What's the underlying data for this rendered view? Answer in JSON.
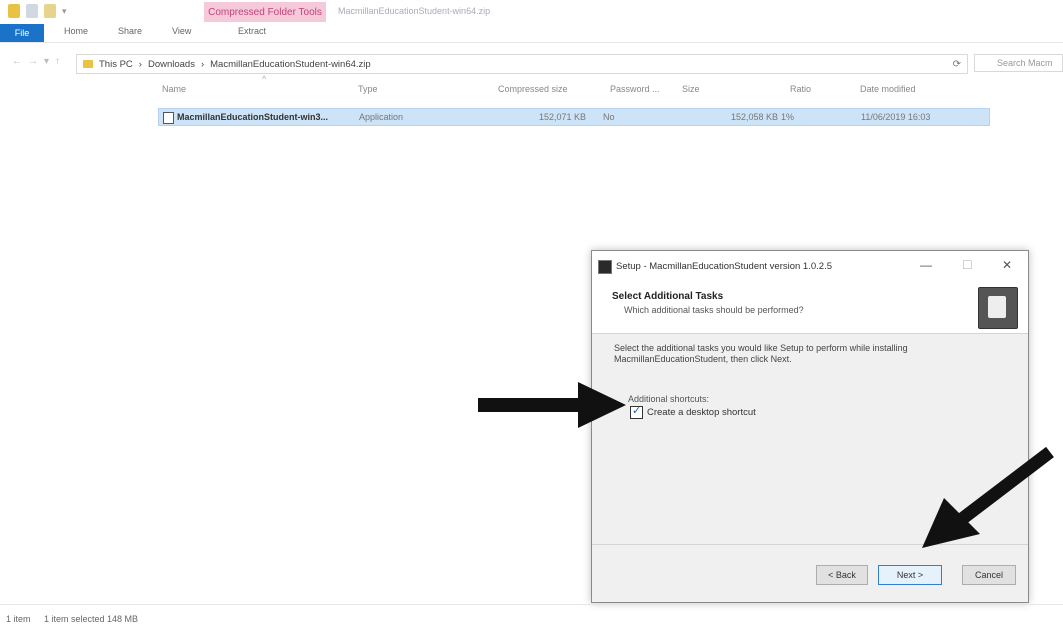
{
  "window": {
    "context_tab": "Compressed Folder Tools",
    "title": "MacmillanEducationStudent-win64.zip"
  },
  "ribbon": {
    "tabs": [
      "File",
      "Home",
      "Share",
      "View",
      "Extract"
    ]
  },
  "address": {
    "crumbs": [
      "This PC",
      "›",
      "Downloads",
      "›",
      "MacmillanEducationStudent-win64.zip"
    ],
    "search_placeholder": "Search Macm"
  },
  "file_list": {
    "columns": [
      "Name",
      "Type",
      "Compressed size",
      "Password ...",
      "Size",
      "Ratio",
      "Date modified"
    ],
    "rows": [
      {
        "name": "MacmillanEducationStudent-win3...",
        "type": "Application",
        "compressed_size": "152,071 KB",
        "password": "No",
        "size": "152,058 KB",
        "ratio": "1%",
        "date_modified": "11/06/2019 16:03"
      }
    ]
  },
  "status": {
    "count": "1 item",
    "selected": "1 item selected  148 MB"
  },
  "dialog": {
    "title": "Setup - MacmillanEducationStudent version 1.0.2.5",
    "min": "—",
    "max": "☐",
    "close": "✕",
    "heading": "Select Additional Tasks",
    "subheading": "Which additional tasks should be performed?",
    "body": "Select the additional tasks you would like Setup to perform while installing MacmillanEducationStudent, then click Next.",
    "additional_label": "Additional shortcuts:",
    "checkbox_label": "Create a desktop shortcut",
    "checkbox_checked": true,
    "back": "< Back",
    "next": "Next >",
    "cancel": "Cancel"
  },
  "colors": {
    "accent": "#1a73c9",
    "context_tab_bg": "#f6c9da",
    "selection": "#cde3f7"
  }
}
